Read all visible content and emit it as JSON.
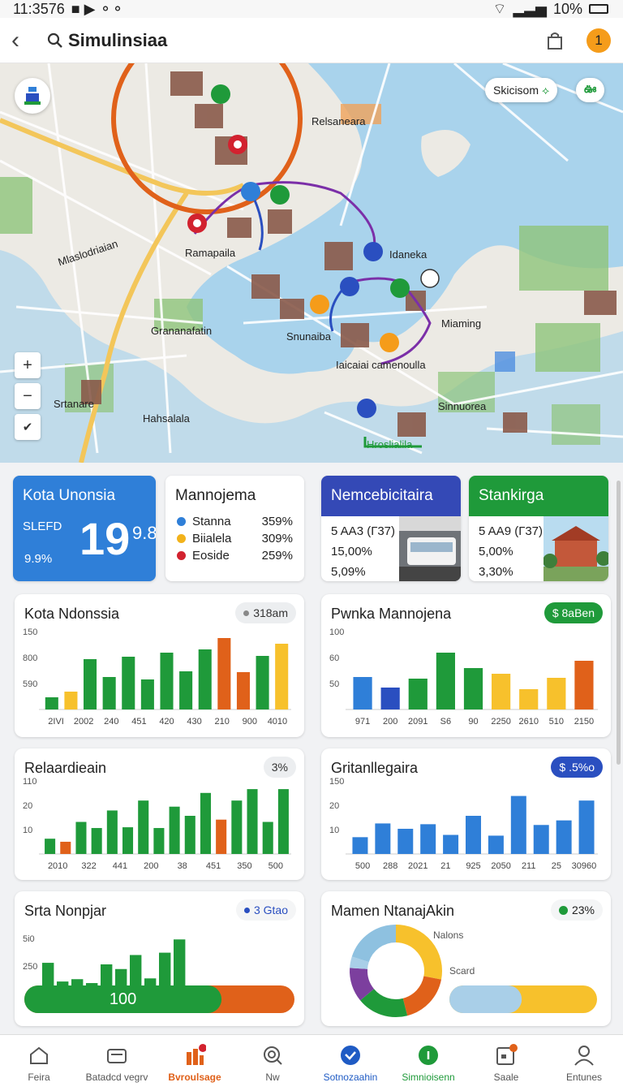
{
  "status_bar": {
    "time": "11:3576",
    "battery": "10%"
  },
  "header": {
    "search_text": "Simulinsiaa",
    "notification_count": "1"
  },
  "map": {
    "chips": [
      "Skicisom",
      "ఊ"
    ],
    "labels": [
      "Relsaneara",
      "Ramapaila",
      "Idaneka",
      "Miaming",
      "Snunaiba",
      "Iaicaiai camenoulla",
      "Grananafatin",
      "Srtanare",
      "Hahsalala",
      "Sinnuorea",
      "Hroslialila",
      "Mlaslodriaian"
    ],
    "zoom_in": "+",
    "zoom_out": "−",
    "locate": "✔"
  },
  "stats": {
    "card1": {
      "title": "Kota Unonsia",
      "sub": "SLEFD",
      "big": "19",
      "small": "9.8",
      "pct": "9.9%"
    },
    "card2": {
      "title": "Mannojema",
      "rows": [
        {
          "label": "Stanna",
          "value": "359%",
          "color": "#2f7fd8"
        },
        {
          "label": "Biialela",
          "value": "309%",
          "color": "#f2b21b"
        },
        {
          "label": "Eoside",
          "value": "259%",
          "color": "#d2222f"
        }
      ]
    },
    "card3": {
      "title": "Nemcebicitaira",
      "lines": [
        "5 AA3 (Г37)",
        "15,00%",
        "5,09%"
      ]
    },
    "card4": {
      "title": "Stankirga",
      "lines": [
        "5 AA9 (Г37)",
        "5,00%",
        "3,30%"
      ]
    }
  },
  "charts": [
    {
      "title": "Kota Ndonssia",
      "pill": "318am",
      "yticks": [
        "150",
        "800",
        "590"
      ],
      "xticks": [
        "2IVI",
        "2002",
        "240",
        "451",
        "420",
        "430",
        "210",
        "900",
        "4010"
      ],
      "values": [
        15,
        22,
        62,
        40,
        65,
        37,
        70,
        47,
        74,
        88,
        46,
        66,
        81
      ],
      "colors": [
        "#1f9a3a",
        "#f7c12c",
        "#1f9a3a",
        "#1f9a3a",
        "#1f9a3a",
        "#1f9a3a",
        "#1f9a3a",
        "#1f9a3a",
        "#1f9a3a",
        "#e0611a",
        "#e0611a",
        "#1f9a3a",
        "#f7c12c"
      ]
    },
    {
      "title": "Pwnka Mannojena",
      "pill": "$ 8aBen",
      "yticks": [
        "100",
        "60",
        "50"
      ],
      "xticks": [
        "971",
        "200",
        "2091",
        "S6",
        "90",
        "2250",
        "2610",
        "510",
        "2150"
      ],
      "values": [
        40,
        27,
        38,
        70,
        51,
        44,
        25,
        39,
        60
      ],
      "colors": [
        "#2f7fd8",
        "#2a4fc0",
        "#1f9a3a",
        "#1f9a3a",
        "#1f9a3a",
        "#f7c12c",
        "#f7c12c",
        "#f7c12c",
        "#e0611a"
      ]
    },
    {
      "title": "Relaardieain",
      "pill": "3%",
      "yticks": [
        "110",
        "20",
        "10"
      ],
      "xticks": [
        "2010",
        "322",
        "441",
        "200",
        "38",
        "451",
        "350",
        "500"
      ],
      "values": [
        20,
        16,
        42,
        34,
        57,
        35,
        70,
        34,
        62,
        50,
        80,
        45,
        70,
        85,
        42,
        85
      ],
      "colors": [
        "#1f9a3a",
        "#e0611a",
        "#1f9a3a",
        "#1f9a3a",
        "#1f9a3a",
        "#1f9a3a",
        "#1f9a3a",
        "#1f9a3a",
        "#1f9a3a",
        "#1f9a3a",
        "#1f9a3a",
        "#e0611a",
        "#1f9a3a",
        "#1f9a3a",
        "#1f9a3a",
        "#1f9a3a"
      ]
    },
    {
      "title": "Gritanllegaira",
      "pill": "$ .5%o",
      "yticks": [
        "150",
        "20",
        "10"
      ],
      "xticks": [
        "500",
        "288",
        "2021",
        "21",
        "925",
        "2050",
        "211",
        "25",
        "30960"
      ],
      "values": [
        22,
        40,
        33,
        39,
        25,
        50,
        24,
        76,
        38,
        44,
        70
      ],
      "colors": [
        "#2f7fd8",
        "#2f7fd8",
        "#2f7fd8",
        "#2f7fd8",
        "#2f7fd8",
        "#2f7fd8",
        "#2f7fd8",
        "#2f7fd8",
        "#2f7fd8",
        "#2f7fd8",
        "#2f7fd8"
      ]
    },
    {
      "title": "Srta Nonpjar",
      "pill": "3 Gtao",
      "yticks": [
        "5i0",
        "250"
      ],
      "xticks": [],
      "values": [
        52,
        28,
        31,
        26,
        50,
        44,
        62,
        32,
        65,
        82,
        22,
        22
      ],
      "colors": [
        "#1f9a3a",
        "#1f9a3a",
        "#1f9a3a",
        "#1f9a3a",
        "#1f9a3a",
        "#1f9a3a",
        "#1f9a3a",
        "#1f9a3a",
        "#1f9a3a",
        "#1f9a3a",
        "#1f9a3a",
        "#1f9a3a"
      ],
      "progress_label": "100",
      "progress_value": 0.73
    },
    {
      "title": "Mamen NtanajAkin",
      "pill": "23%",
      "donut_labels": [
        "Nalons",
        "Scard"
      ],
      "donut_values": [
        28,
        18,
        18,
        12,
        4,
        20
      ],
      "donut_colors": [
        "#f7c12c",
        "#e0611a",
        "#1f9a3a",
        "#7c3f9e",
        "#a9cfe8",
        "#8ec1e0"
      ],
      "bar_split": 0.49
    }
  ],
  "nav": [
    {
      "label": "Feira",
      "icon": "home-icon"
    },
    {
      "label": "Batadcd vegrv",
      "icon": "wallet-icon"
    },
    {
      "label": "Bvroulsage",
      "icon": "building-chart-icon"
    },
    {
      "label": "Nw",
      "icon": "search-icon"
    },
    {
      "label": "Sotnozaahin",
      "icon": "check-circle-icon"
    },
    {
      "label": "Simnioisenn",
      "icon": "info-circle-icon"
    },
    {
      "label": "Saale",
      "icon": "calendar-icon"
    },
    {
      "label": "Entunes",
      "icon": "user-icon"
    }
  ],
  "colors": {
    "blue": "#2f7fd8",
    "green": "#1f9a3a",
    "orange": "#e0611a",
    "yellow": "#f7c12c",
    "indigo": "#2a4fc0"
  }
}
